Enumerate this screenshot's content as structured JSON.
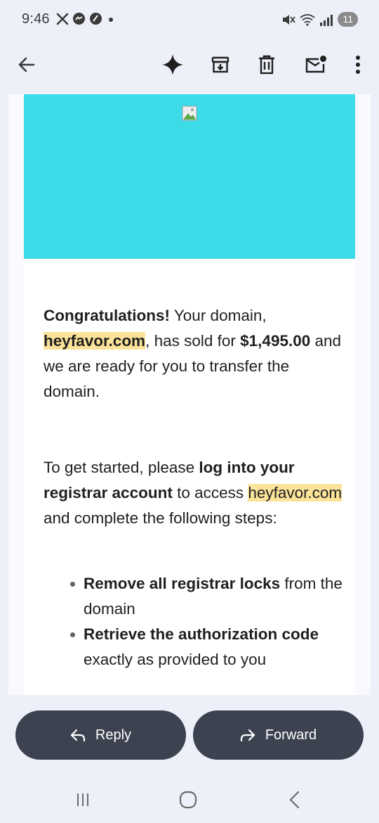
{
  "status_bar": {
    "time": "9:46",
    "notification_icons": [
      "x-logo-icon",
      "messenger-icon",
      "app-notification-icon",
      "more-notifications-dot-icon"
    ],
    "system_icons": [
      "mute-icon",
      "wifi-icon",
      "signal-icon"
    ],
    "battery": "11"
  },
  "app_bar": {
    "icons": [
      "back-arrow-icon",
      "gemini-sparkle-icon",
      "archive-icon",
      "delete-icon",
      "mark-unread-icon",
      "more-vert-icon"
    ]
  },
  "email": {
    "banner_color": "#3cdbe8",
    "paragraph1": {
      "bold_intro": "Congratulations!",
      "text1": " Your domain, ",
      "domain": "heyfavor.com",
      "text2": ", has sold for ",
      "amount": "$1,495.00",
      "text3": " and we are ready for you to transfer the domain."
    },
    "paragraph2": {
      "text1": "To get started, please ",
      "bold": "log into your registrar account",
      "text2": " to access ",
      "domain": "heyfavor.com",
      "text3": " and complete the following steps:"
    },
    "steps": [
      {
        "bold": "Remove all registrar locks",
        "text": " from the domain"
      },
      {
        "bold": "Retrieve the authorization code",
        "text": " exactly as provided to you"
      }
    ]
  },
  "actions": {
    "reply_label": "Reply",
    "forward_label": "Forward"
  },
  "nav_bar": {
    "icons": [
      "recent-apps-icon",
      "home-icon",
      "back-icon"
    ]
  }
}
